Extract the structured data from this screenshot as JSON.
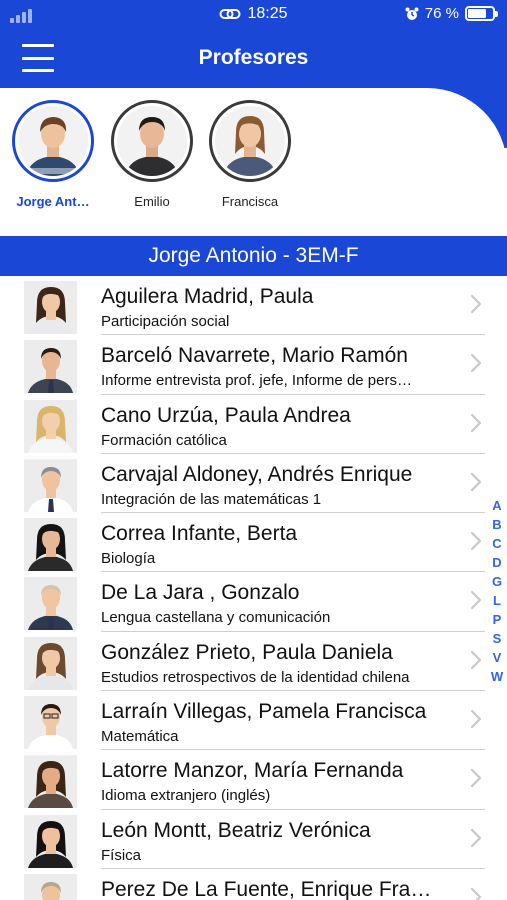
{
  "status_bar": {
    "time": "18:25",
    "battery": "76 %",
    "battery_level": 0.76
  },
  "header": {
    "title": "Profesores"
  },
  "students": [
    {
      "name": "Jorge Ant…",
      "selected": true
    },
    {
      "name": "Emilio",
      "selected": false
    },
    {
      "name": "Francisca",
      "selected": false
    }
  ],
  "section": {
    "title": "Jorge Antonio - 3EM-F"
  },
  "teachers": [
    {
      "name": "Aguilera Madrid, Paula",
      "subject": "Participación social"
    },
    {
      "name": "Barceló Navarrete, Mario Ramón",
      "subject": "Informe entrevista prof. jefe, Informe de pers…"
    },
    {
      "name": "Cano Urzúa, Paula Andrea",
      "subject": "Formación católica"
    },
    {
      "name": "Carvajal Aldoney, Andrés Enrique",
      "subject": "Integración de las matemáticas 1"
    },
    {
      "name": "Correa Infante, Berta",
      "subject": "Biología"
    },
    {
      "name": "De La Jara , Gonzalo",
      "subject": "Lengua castellana y comunicación"
    },
    {
      "name": "González Prieto, Paula Daniela",
      "subject": "Estudios retrospectivos de la identidad chilena"
    },
    {
      "name": "Larraín Villegas, Pamela Francisca",
      "subject": "Matemática"
    },
    {
      "name": "Latorre Manzor, María Fernanda",
      "subject": "Idioma extranjero (inglés)"
    },
    {
      "name": "León Montt, Beatriz Verónica",
      "subject": "Física"
    },
    {
      "name": "Perez De La Fuente, Enrique Fra…",
      "subject": ""
    }
  ],
  "index_letters": [
    "A",
    "B",
    "C",
    "D",
    "G",
    "L",
    "P",
    "S",
    "V",
    "W"
  ],
  "colors": {
    "primary": "#1a47d6",
    "index": "#3366e0",
    "text": "#111111",
    "chevron": "#c7c7cc"
  },
  "icons": {
    "menu": "hamburger-menu-icon",
    "link": "link-icon",
    "alarm": "alarm-clock-icon",
    "battery": "battery-icon",
    "chevron": "chevron-right-icon"
  }
}
